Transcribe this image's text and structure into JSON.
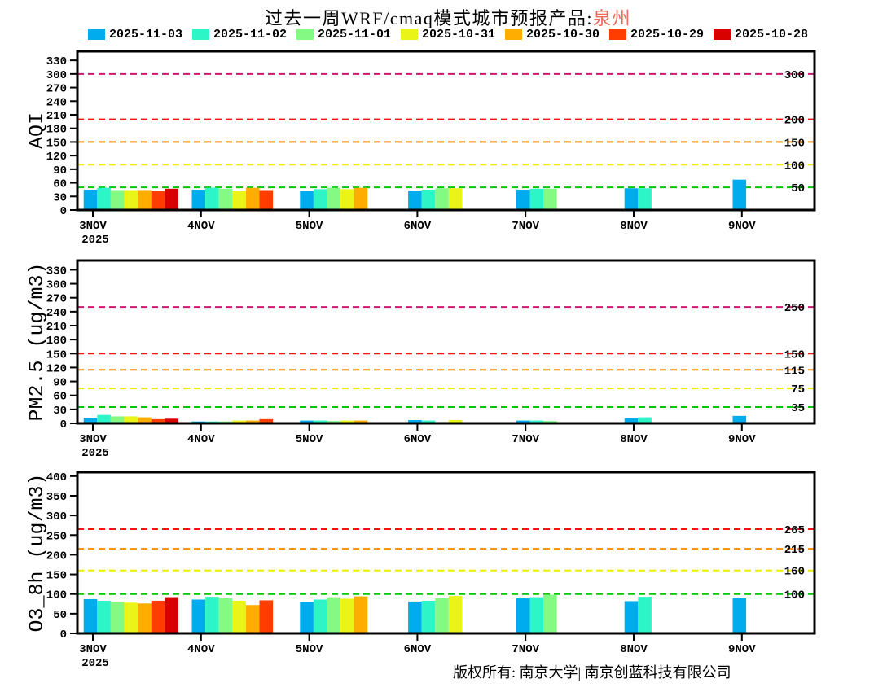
{
  "title": {
    "prefix": "过去一周WRF/cmaq模式城市预报产品:",
    "city": "泉州",
    "city_color": "#ef6a5a"
  },
  "footer": {
    "text": "版权所有: 南京大学| 南京创蓝科技有限公司"
  },
  "chart_data": [
    {
      "type": "bar",
      "ylabel": "AQI",
      "categories": [
        "3NOV",
        "4NOV",
        "5NOV",
        "6NOV",
        "7NOV",
        "8NOV",
        "9NOV"
      ],
      "x_sublabel": "2025",
      "ylim": [
        0,
        350
      ],
      "yticks": [
        0,
        30,
        60,
        90,
        120,
        150,
        180,
        210,
        240,
        270,
        300,
        330
      ],
      "legend_position": "top",
      "grid": false,
      "thresholds": [
        {
          "value": 50,
          "color": "#00c800"
        },
        {
          "value": 100,
          "color": "#eded00"
        },
        {
          "value": 150,
          "color": "#ff8c00"
        },
        {
          "value": 200,
          "color": "#ff1010"
        },
        {
          "value": 300,
          "color": "#cf1770"
        }
      ],
      "series": [
        {
          "name": "2025-11-03",
          "color": "#00acee",
          "values": [
            45,
            45,
            42,
            43,
            45,
            48,
            67
          ]
        },
        {
          "name": "2025-11-02",
          "color": "#2ef5c8",
          "values": [
            49,
            49,
            46,
            45,
            47,
            48,
            null
          ]
        },
        {
          "name": "2025-11-01",
          "color": "#84fa84",
          "values": [
            44,
            47,
            49,
            48,
            47,
            null,
            null
          ]
        },
        {
          "name": "2025-10-31",
          "color": "#ebf417",
          "values": [
            44,
            43,
            46,
            48,
            null,
            null,
            null
          ]
        },
        {
          "name": "2025-10-30",
          "color": "#ffae00",
          "values": [
            44,
            49,
            49,
            null,
            null,
            null,
            null
          ]
        },
        {
          "name": "2025-10-29",
          "color": "#ff3d00",
          "values": [
            42,
            44,
            null,
            null,
            null,
            null,
            null
          ]
        },
        {
          "name": "2025-10-28",
          "color": "#d90000",
          "values": [
            47,
            null,
            null,
            null,
            null,
            null,
            null
          ]
        }
      ]
    },
    {
      "type": "bar",
      "ylabel": "PM2.5 (ug/m3)",
      "categories": [
        "3NOV",
        "4NOV",
        "5NOV",
        "6NOV",
        "7NOV",
        "8NOV",
        "9NOV"
      ],
      "x_sublabel": "2025",
      "ylim": [
        0,
        350
      ],
      "yticks": [
        0,
        30,
        60,
        90,
        120,
        150,
        180,
        210,
        240,
        270,
        300,
        330
      ],
      "grid": false,
      "thresholds": [
        {
          "value": 35,
          "color": "#00c800"
        },
        {
          "value": 75,
          "color": "#eded00"
        },
        {
          "value": 115,
          "color": "#ff8c00"
        },
        {
          "value": 150,
          "color": "#ff1010"
        },
        {
          "value": 250,
          "color": "#cf1770"
        }
      ],
      "series": [
        {
          "name": "2025-11-03",
          "color": "#00acee",
          "values": [
            12,
            4,
            6,
            7,
            6,
            11,
            16
          ]
        },
        {
          "name": "2025-11-02",
          "color": "#2ef5c8",
          "values": [
            18,
            4,
            6,
            6,
            6,
            13,
            null
          ]
        },
        {
          "name": "2025-11-01",
          "color": "#84fa84",
          "values": [
            15,
            4,
            5,
            3,
            5,
            null,
            null
          ]
        },
        {
          "name": "2025-10-31",
          "color": "#ebf417",
          "values": [
            15,
            6,
            6,
            7,
            null,
            null,
            null
          ]
        },
        {
          "name": "2025-10-30",
          "color": "#ffae00",
          "values": [
            13,
            6,
            6,
            null,
            null,
            null,
            null
          ]
        },
        {
          "name": "2025-10-29",
          "color": "#ff3d00",
          "values": [
            9,
            9,
            null,
            null,
            null,
            null,
            null
          ]
        },
        {
          "name": "2025-10-28",
          "color": "#d90000",
          "values": [
            10,
            null,
            null,
            null,
            null,
            null,
            null
          ]
        }
      ]
    },
    {
      "type": "bar",
      "ylabel": "O3_8h (ug/m3)",
      "categories": [
        "3NOV",
        "4NOV",
        "5NOV",
        "6NOV",
        "7NOV",
        "8NOV",
        "9NOV"
      ],
      "x_sublabel": "2025",
      "ylim": [
        0,
        410
      ],
      "yticks": [
        0,
        50,
        100,
        150,
        200,
        250,
        300,
        350,
        400
      ],
      "grid": false,
      "thresholds": [
        {
          "value": 100,
          "color": "#00c800"
        },
        {
          "value": 160,
          "color": "#eded00"
        },
        {
          "value": 215,
          "color": "#ff8c00"
        },
        {
          "value": 265,
          "color": "#ff1010"
        }
      ],
      "series": [
        {
          "name": "2025-11-03",
          "color": "#00acee",
          "values": [
            87,
            86,
            80,
            81,
            89,
            82,
            89
          ]
        },
        {
          "name": "2025-11-02",
          "color": "#2ef5c8",
          "values": [
            83,
            93,
            86,
            83,
            92,
            93,
            null
          ]
        },
        {
          "name": "2025-11-01",
          "color": "#84fa84",
          "values": [
            81,
            89,
            92,
            90,
            98,
            null,
            null
          ]
        },
        {
          "name": "2025-10-31",
          "color": "#ebf417",
          "values": [
            78,
            83,
            88,
            95,
            null,
            null,
            null
          ]
        },
        {
          "name": "2025-10-30",
          "color": "#ffae00",
          "values": [
            76,
            72,
            94,
            null,
            null,
            null,
            null
          ]
        },
        {
          "name": "2025-10-29",
          "color": "#ff3d00",
          "values": [
            83,
            84,
            null,
            null,
            null,
            null,
            null
          ]
        },
        {
          "name": "2025-10-28",
          "color": "#d90000",
          "values": [
            92,
            null,
            null,
            null,
            null,
            null,
            null
          ]
        }
      ]
    }
  ]
}
